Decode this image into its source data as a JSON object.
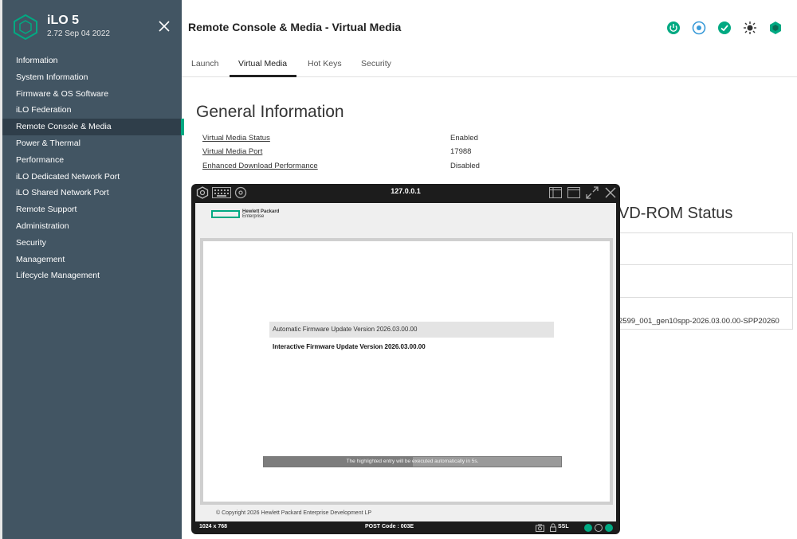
{
  "app": {
    "name": "iLO 5",
    "version": "2.72 Sep 04 2022"
  },
  "sidebar": {
    "items": [
      {
        "label": "Information"
      },
      {
        "label": "System Information"
      },
      {
        "label": "Firmware & OS Software"
      },
      {
        "label": "iLO Federation"
      },
      {
        "label": "Remote Console & Media",
        "active": true
      },
      {
        "label": "Power & Thermal"
      },
      {
        "label": "Performance"
      },
      {
        "label": "iLO Dedicated Network Port"
      },
      {
        "label": "iLO Shared Network Port"
      },
      {
        "label": "Remote Support"
      },
      {
        "label": "Administration"
      },
      {
        "label": "Security"
      },
      {
        "label": "Management"
      },
      {
        "label": "Lifecycle Management"
      }
    ]
  },
  "header": {
    "title": "Remote Console & Media - Virtual Media",
    "icons": [
      "power-icon",
      "locator-icon",
      "health-ok-icon",
      "settings-sun-icon",
      "security-shield-icon"
    ]
  },
  "tabs": [
    {
      "label": "Launch"
    },
    {
      "label": "Virtual Media",
      "active": true
    },
    {
      "label": "Hot Keys"
    },
    {
      "label": "Security"
    }
  ],
  "general": {
    "title": "General Information",
    "rows": [
      {
        "label": "Virtual Media Status",
        "value": "Enabled"
      },
      {
        "label": "Virtual Media Port",
        "value": "17988"
      },
      {
        "label": "Enhanced Download Performance",
        "value": "Disabled"
      }
    ]
  },
  "dvd": {
    "title": "VD-ROM Status",
    "file": "2599_001_gen10spp-2026.03.00.00-SPP20260"
  },
  "console": {
    "host": "127.0.0.1",
    "brand_line1": "Hewlett Packard",
    "brand_line2": "Enterprise",
    "menu_selected": "Automatic Firmware Update Version 2026.03.00.00",
    "menu_item": "Interactive Firmware Update Version 2026.03.00.00",
    "progress_text": "The highlighted entry will be executed automatically in 5s.",
    "progress_fraction": 0.5,
    "copyright": "© Copyright 2026 Hewlett Packard Enterprise Development LP",
    "resolution": "1024 x 768",
    "post_code": "POST Code : 003E",
    "ssl": "SSL"
  },
  "colors": {
    "sidebar": "#425563",
    "accent": "#01a982",
    "console_bg": "#1c1c1c"
  }
}
